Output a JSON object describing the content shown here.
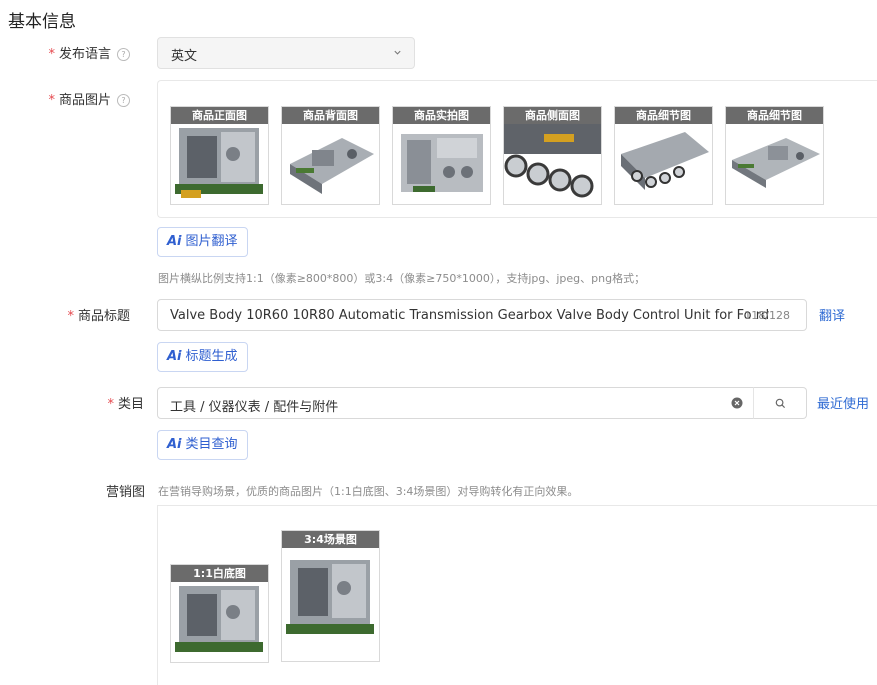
{
  "section_title": "基本信息",
  "language": {
    "label": "发布语言",
    "value": "英文",
    "icon": "chevron-down-icon"
  },
  "images": {
    "label": "商品图片",
    "thumbnails": [
      {
        "caption": "商品正面图"
      },
      {
        "caption": "商品背面图"
      },
      {
        "caption": "商品实拍图"
      },
      {
        "caption": "商品侧面图"
      },
      {
        "caption": "商品细节图"
      },
      {
        "caption": "商品细节图"
      }
    ],
    "ai_button": {
      "ai": "Ai",
      "label": "图片翻译"
    },
    "hint": "图片横纵比例支持1:1（像素≥800*800）或3:4（像素≥750*1000），支持jpg、jpeg、png格式；"
  },
  "title": {
    "label": "商品标题",
    "value": "Valve Body 10R60 10R80 Automatic Transmission Gearbox Valve Body Control Unit for Fo rd",
    "counter": "118/128",
    "translate_link": "翻译",
    "ai_button": {
      "ai": "Ai",
      "label": "标题生成"
    }
  },
  "category": {
    "label": "类目",
    "value": "工具 / 仪器仪表 / 配件与附件",
    "recent_link": "最近使用",
    "ai_button": {
      "ai": "Ai",
      "label": "类目查询"
    }
  },
  "marketing": {
    "label": "营销图",
    "hint": "在营销导购场景，优质的商品图片（1:1白底图、3:4场景图）对导购转化有正向效果。",
    "items": [
      {
        "caption": "1:1白底图"
      },
      {
        "caption": "3:4场景图"
      }
    ]
  },
  "colors": {
    "required": "#e5484d",
    "link": "#2f6bd3",
    "ai_accent": "#2f5fd0",
    "caption_bg": "#6b6b6b"
  }
}
